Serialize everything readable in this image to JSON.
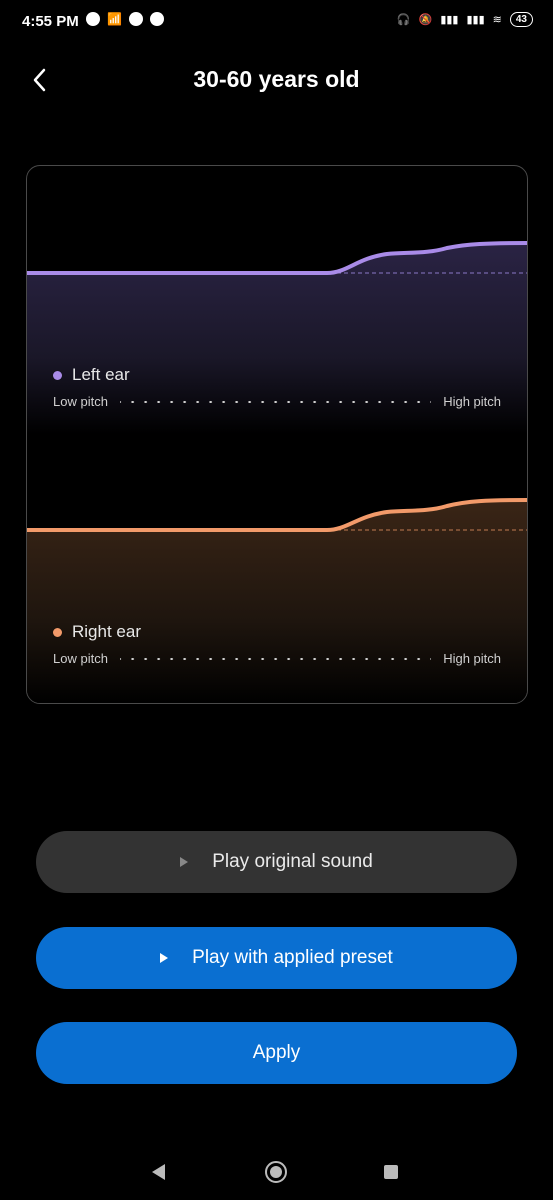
{
  "status_bar": {
    "time": "4:55 PM",
    "left_icons": [
      "spotify-icon",
      "signal-icon",
      "telegram-icon",
      "telegram-icon"
    ],
    "right_icons": [
      "headphones-icon",
      "mute-icon",
      "volte-signal-icon",
      "4g-signal-icon",
      "wifi-icon"
    ],
    "battery": "43"
  },
  "header": {
    "title": "30-60 years old",
    "back_icon": "chevron-left-icon"
  },
  "chart": {
    "left_ear": {
      "label": "Left ear",
      "color": "#a98be8",
      "low_label": "Low pitch",
      "high_label": "High pitch",
      "curve": [
        0,
        0,
        0,
        0,
        0,
        0,
        0,
        0,
        0.7,
        0.95,
        1
      ]
    },
    "right_ear": {
      "label": "Right ear",
      "color": "#f29a6a",
      "low_label": "Low pitch",
      "high_label": "High pitch",
      "curve": [
        0,
        0,
        0,
        0,
        0,
        0,
        0,
        0,
        0.7,
        0.95,
        1
      ]
    }
  },
  "buttons": {
    "play_original": "Play original sound",
    "play_preset": "Play with applied preset",
    "apply": "Apply"
  },
  "nav_bar": {
    "icons": [
      "back-nav-icon",
      "home-nav-icon",
      "recents-nav-icon"
    ]
  }
}
